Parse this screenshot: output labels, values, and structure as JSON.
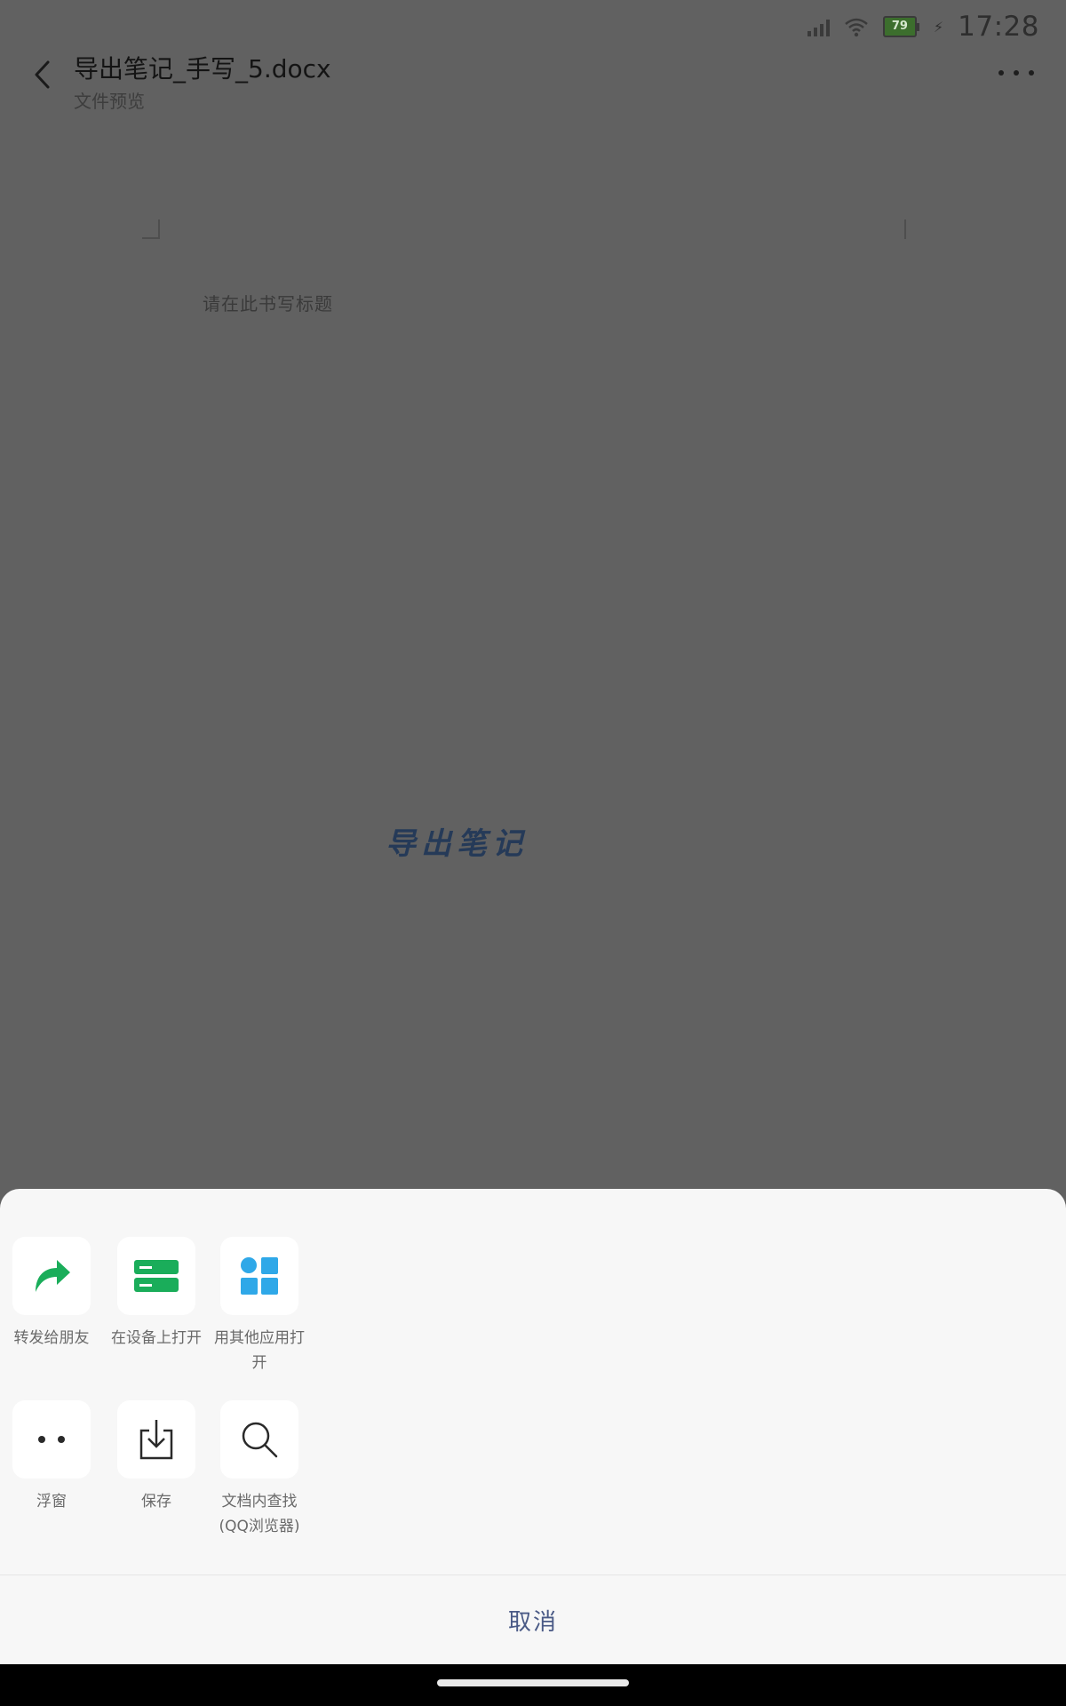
{
  "status_bar": {
    "time": "17:28",
    "battery": "79"
  },
  "header": {
    "title": "导出笔记_手写_5.docx",
    "subtitle": "文件预览"
  },
  "document": {
    "hint": "请在此书写标题",
    "handwriting": "导出笔记"
  },
  "sheet": {
    "actions": [
      {
        "label": "转发给朋友",
        "icon": "share-arrow-icon"
      },
      {
        "label": "在设备上打开",
        "icon": "device-icon"
      },
      {
        "label": "用其他应用打开",
        "icon": "apps-grid-icon"
      },
      {
        "label": "浮窗",
        "icon": "float-window-icon"
      },
      {
        "label": "保存",
        "icon": "save-download-icon"
      },
      {
        "label": "文档内查找(QQ浏览器)",
        "icon": "search-icon"
      }
    ],
    "cancel": "取消"
  },
  "colors": {
    "accent_green": "#1aad5a",
    "accent_blue": "#2fa8e8",
    "cancel_text": "#4a5a86"
  }
}
